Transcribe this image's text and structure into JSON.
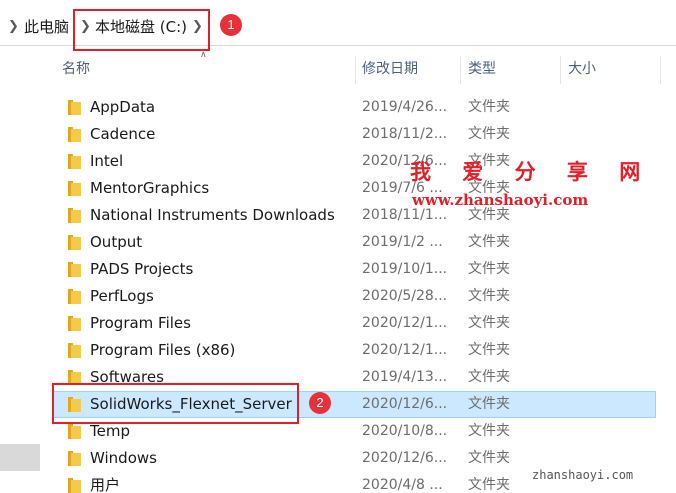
{
  "breadcrumb": {
    "items": [
      "此电脑",
      "本地磁盘 (C:)"
    ]
  },
  "columns": {
    "name": "名称",
    "date": "修改日期",
    "type": "类型",
    "size": "大小"
  },
  "rows": [
    {
      "name": "AppData",
      "date": "2019/4/26...",
      "type": "文件夹"
    },
    {
      "name": "Cadence",
      "date": "2018/11/2...",
      "type": "文件夹"
    },
    {
      "name": "Intel",
      "date": "2020/12/6...",
      "type": "文件夹"
    },
    {
      "name": "MentorGraphics",
      "date": "2019/7/6 ...",
      "type": "文件夹"
    },
    {
      "name": "National Instruments Downloads",
      "date": "2018/11/1...",
      "type": "文件夹"
    },
    {
      "name": "Output",
      "date": "2019/1/2 ...",
      "type": "文件夹"
    },
    {
      "name": "PADS Projects",
      "date": "2019/10/1...",
      "type": "文件夹"
    },
    {
      "name": "PerfLogs",
      "date": "2020/5/28...",
      "type": "文件夹"
    },
    {
      "name": "Program Files",
      "date": "2020/12/1...",
      "type": "文件夹"
    },
    {
      "name": "Program Files (x86)",
      "date": "2020/12/1...",
      "type": "文件夹"
    },
    {
      "name": "Softwares",
      "date": "2019/4/13...",
      "type": "文件夹"
    },
    {
      "name": "SolidWorks_Flexnet_Server",
      "date": "2020/12/6...",
      "type": "文件夹",
      "selected": true
    },
    {
      "name": "Temp",
      "date": "2020/10/8...",
      "type": "文件夹"
    },
    {
      "name": "Windows",
      "date": "2020/12/6...",
      "type": "文件夹"
    },
    {
      "name": "用户",
      "date": "2020/4/8 ...",
      "type": "文件夹"
    }
  ],
  "annotations": {
    "badge1": "1",
    "badge2": "2"
  },
  "watermark": {
    "title": "我 爱 分 享 网",
    "url": "www.zhanshaoyi.com",
    "corner": "zhanshaoyi.com"
  },
  "colors": {
    "annotation_red": "#e0202a",
    "selection_bg": "#cce8ff",
    "selection_border": "#99d1ff",
    "folder_yellow": "#f5c94a"
  }
}
